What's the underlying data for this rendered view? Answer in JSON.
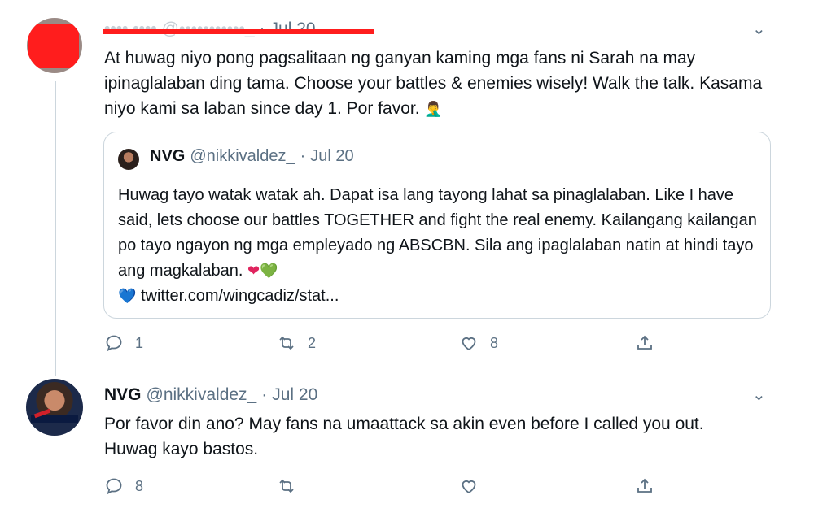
{
  "tweet1": {
    "name_redacted": "•••• ••••",
    "handle_redacted": "@•••••••••••_",
    "dot": "·",
    "date": "Jul 20",
    "text": "At huwag niyo pong pagsalitaan ng ganyan kaming mga fans ni Sarah na may ipinaglalaban ding tama. Choose your battles & enemies wisely! Walk the talk. Kasama niyo kami sa laban since day 1. Por favor.",
    "text_emoji": "🤦‍♂️",
    "quote": {
      "name": "NVG",
      "handle": "@nikkivaldez_",
      "dot": "·",
      "date": "Jul 20",
      "text": "Huwag tayo watak watak ah. Dapat isa lang tayong lahat sa pinaglalaban. Like I have said, lets choose our battles TOGETHER and fight the real enemy. Kailangang kailangan po tayo ngayon ng mga empleyado ng ABSCBN. Sila ang ipaglalaban natin at hindi tayo ang magkalaban.",
      "hearts": [
        "❤",
        "💚",
        "💙"
      ],
      "link": "twitter.com/wingcadiz/stat..."
    },
    "actions": {
      "reply_count": "1",
      "retweet_count": "2",
      "like_count": "8"
    }
  },
  "tweet2": {
    "name": "NVG",
    "handle": "@nikkivaldez_",
    "dot": "·",
    "date": "Jul 20",
    "text": "Por favor din ano? May fans na umaattack sa akin even before I called you out. Huwag kayo bastos.",
    "actions": {
      "reply_count": "8",
      "retweet_count": "",
      "like_count": ""
    }
  },
  "icons": {
    "reply": "reply-icon",
    "retweet": "retweet-icon",
    "like": "heart-icon",
    "share": "share-icon",
    "menu": "chevron-down-icon"
  },
  "colors": {
    "text": "#0f1419",
    "secondary": "#5b7083",
    "border": "#ccd6dd",
    "redaction": "#ff1d1d"
  }
}
